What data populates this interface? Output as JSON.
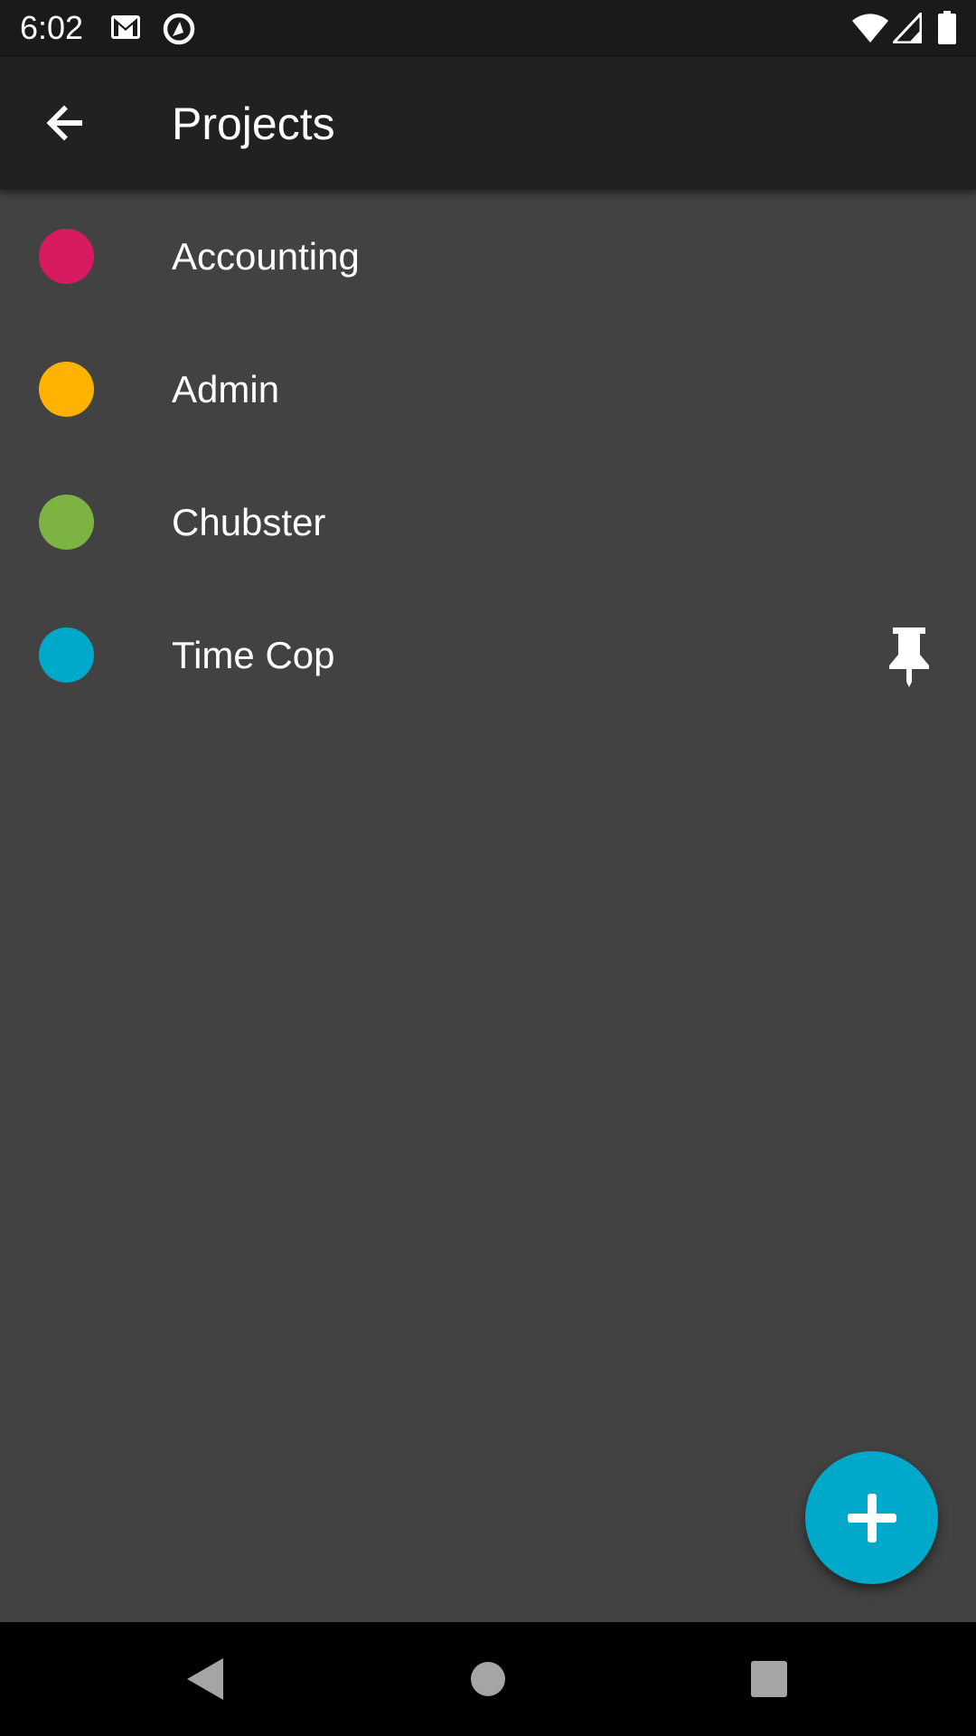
{
  "status_bar": {
    "time": "6:02",
    "icons": [
      "gmail-icon",
      "sync-icon",
      "wifi-icon",
      "signal-icon",
      "battery-icon"
    ]
  },
  "app_bar": {
    "title": "Projects",
    "back_icon": "arrow-back-icon"
  },
  "projects": [
    {
      "name": "Accounting",
      "color": "#d81b60",
      "pinned": false
    },
    {
      "name": "Admin",
      "color": "#ffb300",
      "pinned": false
    },
    {
      "name": "Chubster",
      "color": "#7cb342",
      "pinned": false
    },
    {
      "name": "Time Cop",
      "color": "#00a9c9",
      "pinned": true
    }
  ],
  "fab": {
    "icon": "plus-icon",
    "color": "#00a9c9"
  },
  "nav_bar": {
    "buttons": [
      "back-triangle-icon",
      "home-circle-icon",
      "recents-square-icon"
    ]
  },
  "theme": {
    "background": "#424242",
    "app_bar": "#212121",
    "status_bar": "#1a1a1a"
  }
}
